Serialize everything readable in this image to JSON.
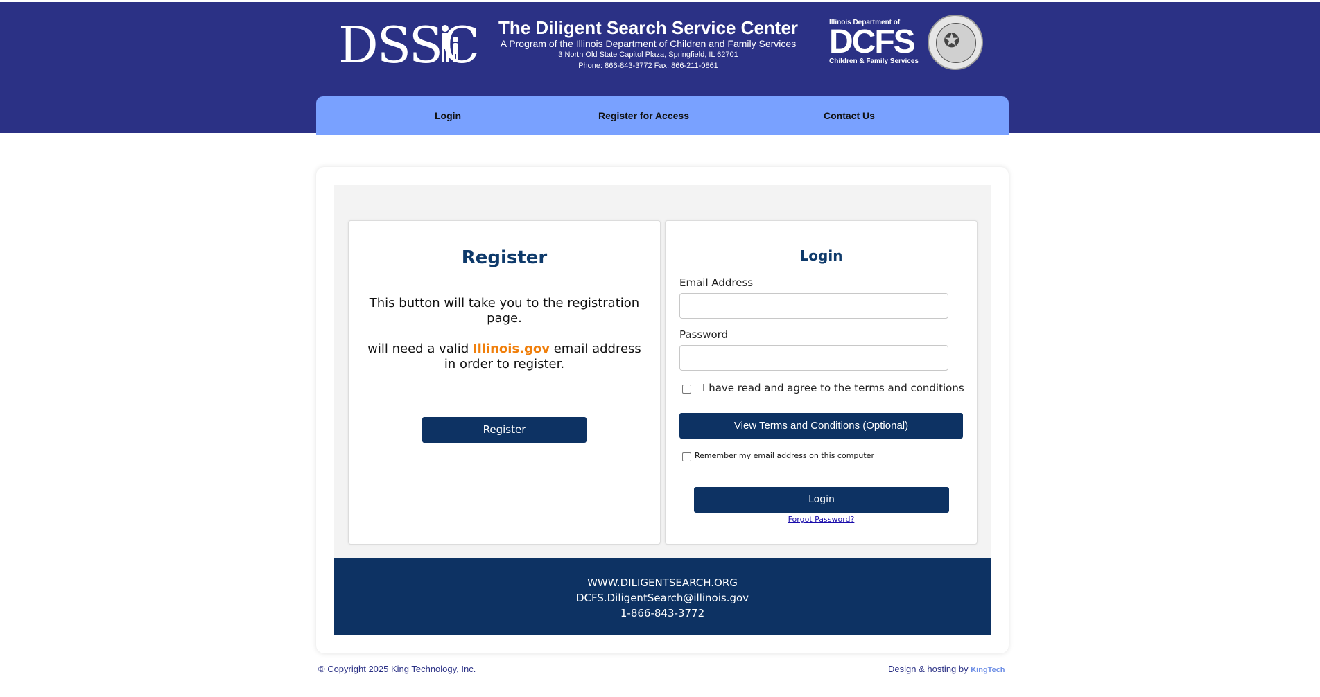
{
  "header": {
    "dssc_logo": "DSSC",
    "title": "The Diligent Search Service Center",
    "subtitle": "A Program of the Illinois Department of Children and Family Services",
    "address": "3 North Old State Capitol Plaza, Springfield, IL 62701",
    "phone_fax": "Phone: 866-843-3772  Fax: 866-211-0861",
    "dcfs_top": "Illinois Department of",
    "dcfs_big": "DCFS",
    "dcfs_sub": "Children & Family Services"
  },
  "nav": {
    "items": [
      {
        "label": "Login"
      },
      {
        "label": "Register for Access"
      },
      {
        "label": "Contact Us"
      }
    ]
  },
  "register": {
    "title": "Register",
    "text1": "This button will take you to the registration page.",
    "text2_prefix": "will need a valid ",
    "text2_highlight": "Illinois.gov",
    "text2_suffix": " email address in order to register.",
    "button": "Register"
  },
  "login": {
    "title": "Login",
    "email_label": "Email Address",
    "email_value": "",
    "password_label": "Password",
    "password_value": "",
    "terms_label": "I have read and agree to the terms and conditions",
    "terms_button": "View Terms and Conditions (Optional)",
    "remember_label": "Remember my email address on this computer",
    "login_button": "Login",
    "forgot": "Forgot Password?"
  },
  "contact": {
    "website": "WWW.DILIGENTSEARCH.ORG",
    "email": "DCFS.DiligentSearch@illinois.gov",
    "phone": "1-866-843-3772"
  },
  "footer": {
    "copyright": "© Copyright 2025 King Technology, Inc.",
    "design_prefix": "Design & hosting by ",
    "design_brand": "KingTech"
  },
  "colors": {
    "header_bg": "#2b3185",
    "nav_bg": "#79a1ff",
    "primary_button": "#0d3263",
    "accent_orange": "#f07f0b"
  }
}
